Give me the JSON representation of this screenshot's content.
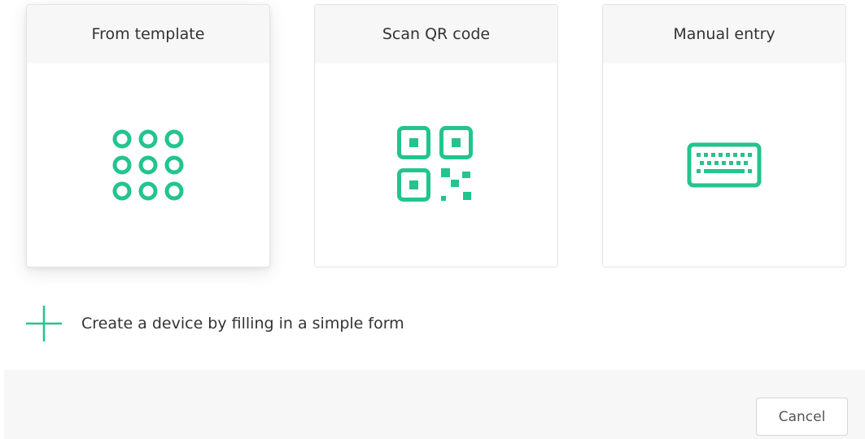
{
  "cards": [
    {
      "title": "From template",
      "icon": "grid-dots-icon"
    },
    {
      "title": "Scan QR code",
      "icon": "qr-code-icon"
    },
    {
      "title": "Manual entry",
      "icon": "keyboard-icon"
    }
  ],
  "create": {
    "label": "Create a device by filling in a simple form",
    "icon": "plus-icon"
  },
  "footer": {
    "cancel_label": "Cancel"
  },
  "colors": {
    "accent": "#23c48e",
    "card_header_bg": "#f7f7f7",
    "footer_bg": "#f7f7f7",
    "text": "#333333"
  }
}
